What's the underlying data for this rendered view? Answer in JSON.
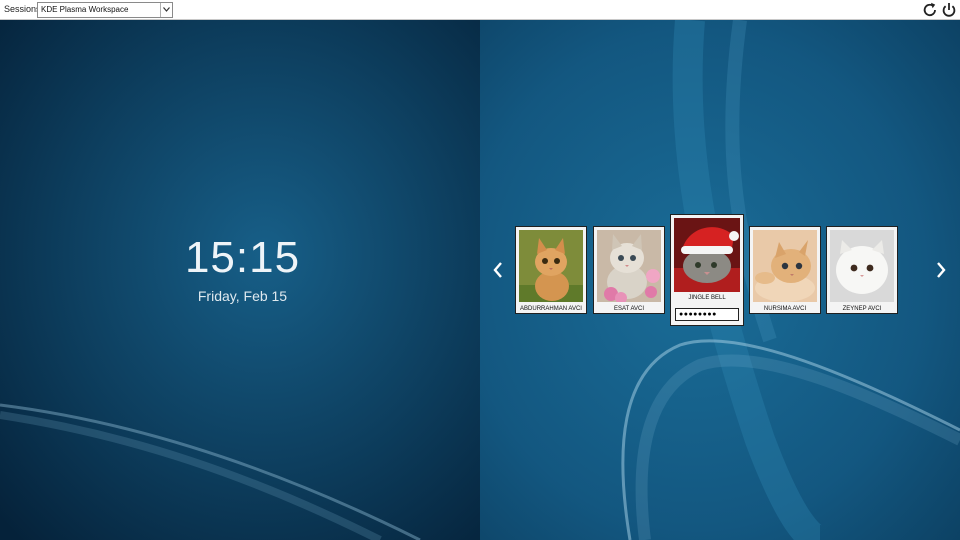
{
  "topbar": {
    "sessions_label": "Sessions:",
    "session_selected": "KDE Plasma Workspace",
    "restart_icon": "restart-icon",
    "shutdown_icon": "power-icon"
  },
  "clock": {
    "time": "15:15",
    "date": "Friday, Feb 15"
  },
  "users": [
    {
      "name": "ABDURRAHMAN AVCI",
      "photo": "kitten-orange"
    },
    {
      "name": "ESAT AVCI",
      "photo": "kitten-fluffy-flowers"
    },
    {
      "name": "JINGLE BELL",
      "photo": "kitten-santa-hat",
      "active": true
    },
    {
      "name": "NURSIMA AVCI",
      "photo": "kitten-lying-cream"
    },
    {
      "name": "ZEYNEP AVCI",
      "photo": "kitten-white-persian"
    }
  ],
  "password": {
    "masked_value": "●●●●●●●●"
  },
  "navigation": {
    "prev_icon": "chevron-left-icon",
    "next_icon": "chevron-right-icon"
  },
  "colors": {
    "background_dark": "#06243a",
    "background_mid": "#145a80",
    "topbar": "#ffffff",
    "card": "#f4f4f4"
  }
}
